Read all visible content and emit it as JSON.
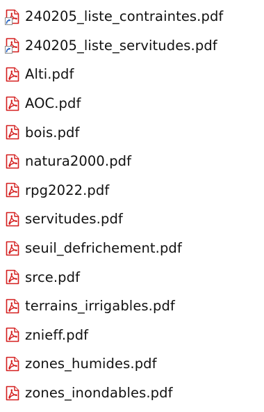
{
  "files": [
    {
      "name": "240205_liste_contraintes.pdf",
      "icon": "pdf-icon",
      "shortcut": true
    },
    {
      "name": "240205_liste_servitudes.pdf",
      "icon": "pdf-icon",
      "shortcut": true
    },
    {
      "name": "Alti.pdf",
      "icon": "pdf-icon",
      "shortcut": false
    },
    {
      "name": "AOC.pdf",
      "icon": "pdf-icon",
      "shortcut": false
    },
    {
      "name": "bois.pdf",
      "icon": "pdf-icon",
      "shortcut": false
    },
    {
      "name": "natura2000.pdf",
      "icon": "pdf-icon",
      "shortcut": false
    },
    {
      "name": "rpg2022.pdf",
      "icon": "pdf-icon",
      "shortcut": false
    },
    {
      "name": "servitudes.pdf",
      "icon": "pdf-icon",
      "shortcut": false
    },
    {
      "name": "seuil_defrichement.pdf",
      "icon": "pdf-icon",
      "shortcut": false
    },
    {
      "name": "srce.pdf",
      "icon": "pdf-icon",
      "shortcut": false
    },
    {
      "name": "terrains_irrigables.pdf",
      "icon": "pdf-icon",
      "shortcut": false
    },
    {
      "name": "znieff.pdf",
      "icon": "pdf-icon",
      "shortcut": false
    },
    {
      "name": "zones_humides.pdf",
      "icon": "pdf-icon",
      "shortcut": false
    },
    {
      "name": "zones_inondables.pdf",
      "icon": "pdf-icon",
      "shortcut": false
    }
  ],
  "colors": {
    "pdf_red": "#d41d1d",
    "shortcut_blue": "#1f5fbf",
    "text": "#111111"
  }
}
